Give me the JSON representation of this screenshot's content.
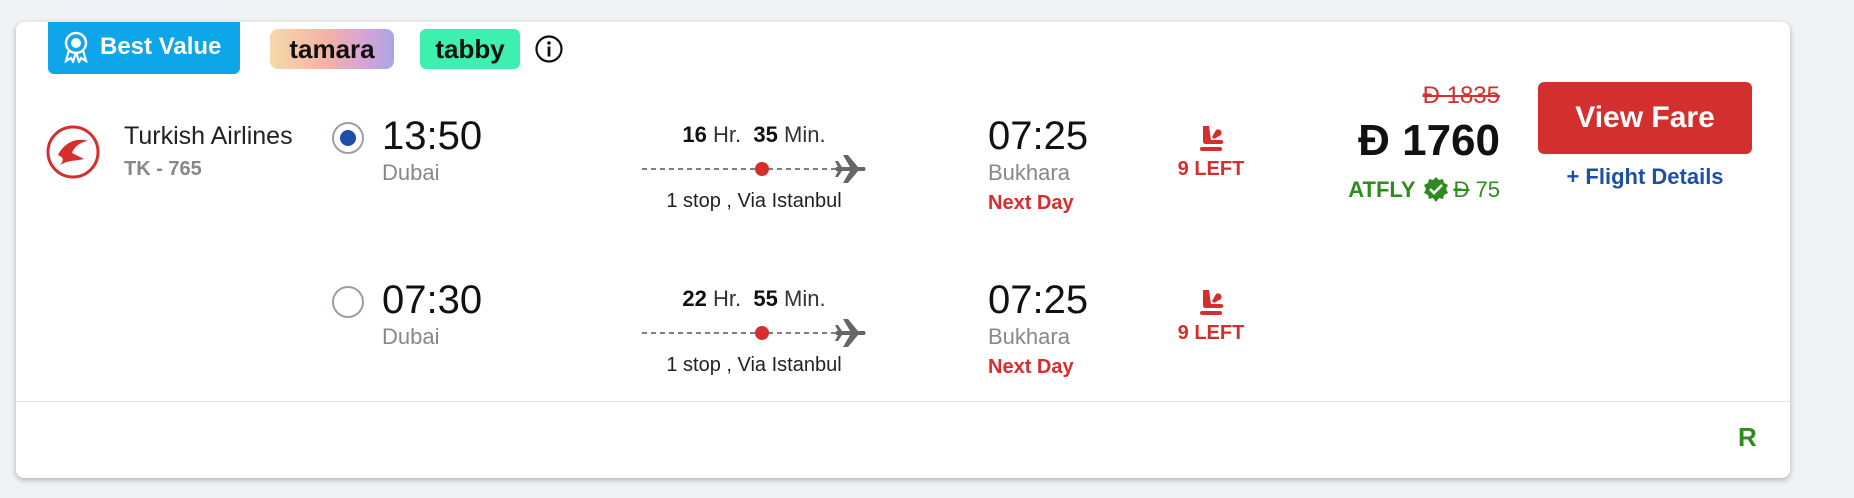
{
  "badges": {
    "best_value": "Best Value",
    "tamara": "tamara",
    "tabby": "tabby"
  },
  "airline": {
    "name": "Turkish Airlines",
    "flight_no": "TK - 765"
  },
  "options": [
    {
      "selected": true,
      "depart_time": "13:50",
      "depart_city": "Dubai",
      "duration_hr": "16",
      "hr_label": "Hr.",
      "duration_min": "35",
      "min_label": "Min.",
      "stops": "1 stop , Via Istanbul",
      "arrive_time": "07:25",
      "arrive_city": "Bukhara",
      "next_day": "Next Day",
      "seats_left": "9 LEFT"
    },
    {
      "selected": false,
      "depart_time": "07:30",
      "depart_city": "Dubai",
      "duration_hr": "22",
      "hr_label": "Hr.",
      "duration_min": "55",
      "min_label": "Min.",
      "stops": "1 stop , Via Istanbul",
      "arrive_time": "07:25",
      "arrive_city": "Bukhara",
      "next_day": "Next Day",
      "seats_left": "9 LEFT"
    }
  ],
  "pricing": {
    "currency_symbol": "Đ",
    "old_price": "1835",
    "price": "1760",
    "promo_code": "ATFLY",
    "promo_amount": "75"
  },
  "actions": {
    "view_fare": "View Fare",
    "flight_details": "+ Flight Details"
  },
  "footer": {
    "letter": "R"
  },
  "colors": {
    "best_value": "#0ea5e9",
    "tabby": "#3ef0b0",
    "accent_red": "#d32f2f",
    "link_blue": "#1e4fa8",
    "promo_green": "#2e8b1e"
  },
  "icons": [
    "award-icon",
    "info-icon",
    "turkish-airlines-logo",
    "plane-icon",
    "seat-icon",
    "verified-check-icon"
  ]
}
